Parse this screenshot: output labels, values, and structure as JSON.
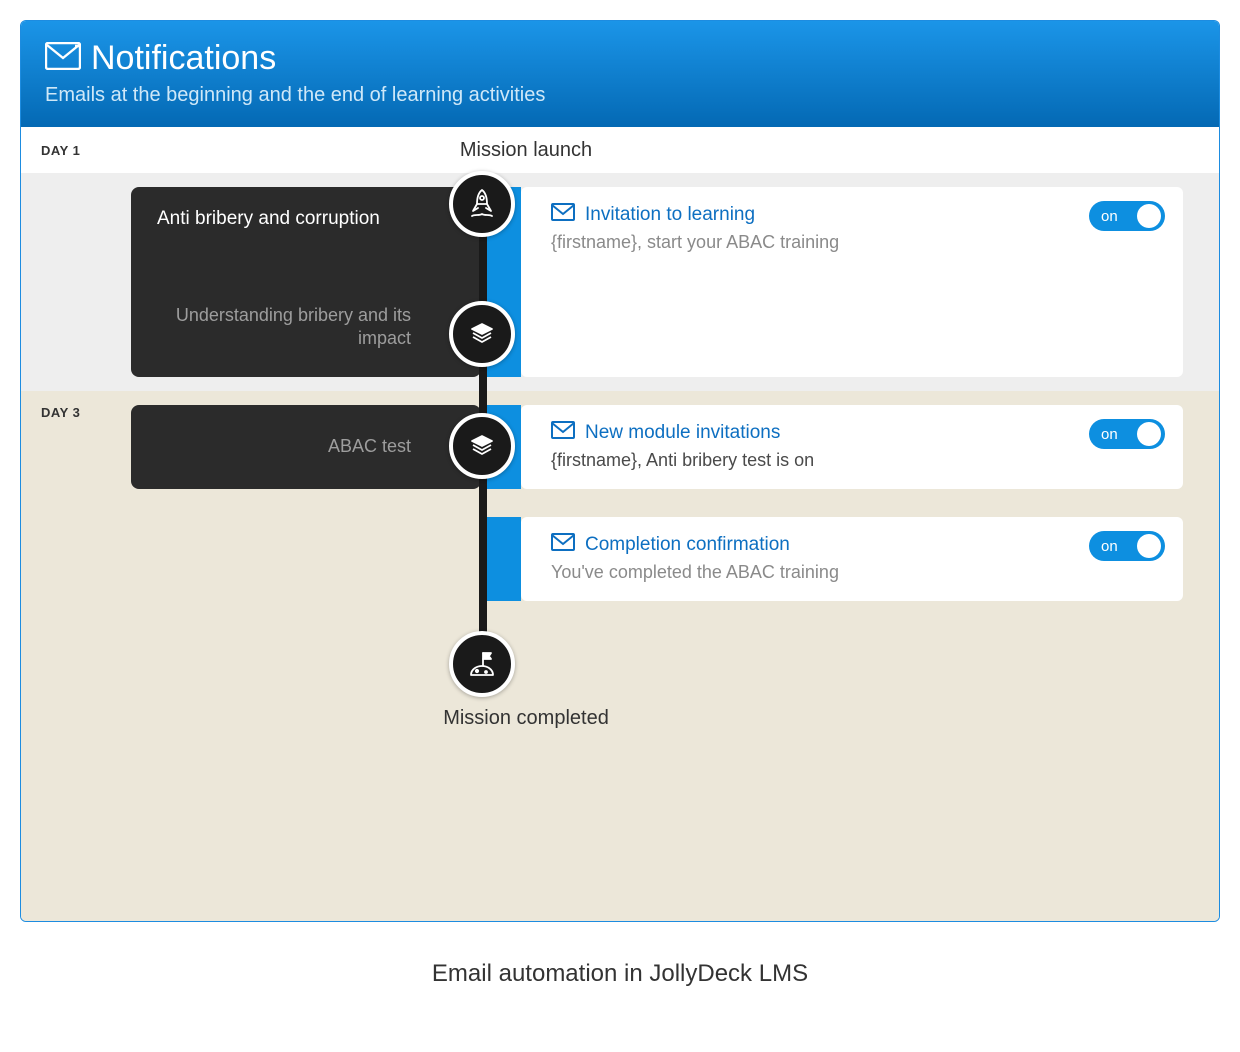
{
  "header": {
    "title": "Notifications",
    "subtitle": "Emails at the beginning and the end of learning activities"
  },
  "labels": {
    "launch": "Mission launch",
    "completed": "Mission completed"
  },
  "toggle_on": "on",
  "sections": [
    {
      "day": "DAY 1",
      "mission": {
        "title": "Anti bribery and corruption",
        "item": "Understanding bribery and its impact"
      },
      "email": {
        "title": "Invitation to learning",
        "subject": "{firstname}, start your ABAC training",
        "on": true
      }
    },
    {
      "day": "DAY 3",
      "mission": {
        "item": "ABAC test"
      },
      "emails": [
        {
          "title": "New module invitations",
          "subject": "{firstname}, Anti bribery test is on",
          "on": true
        },
        {
          "title": "Completion confirmation",
          "subject": "You've completed the ABAC training",
          "on": true
        }
      ]
    }
  ],
  "caption": "Email automation in JollyDeck LMS"
}
